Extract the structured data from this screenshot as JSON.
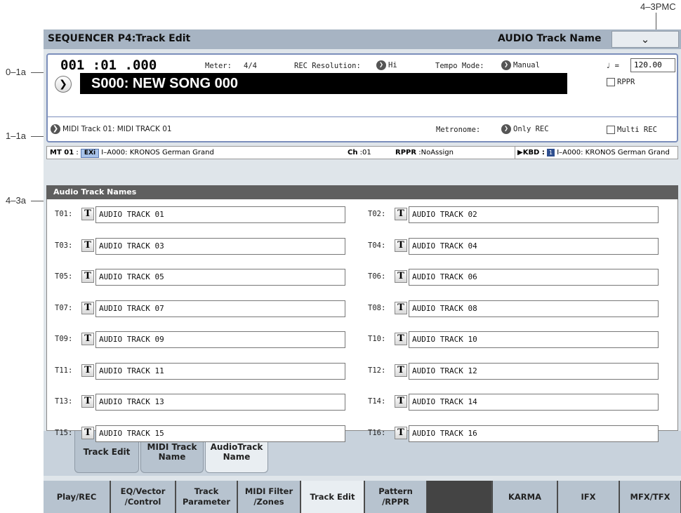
{
  "annotations": {
    "top_right": "4–3PMC",
    "label_0_1a": "0–1a",
    "label_1_1a": "1–1a",
    "label_4_3a": "4–3a"
  },
  "titlebar": {
    "title": "SEQUENCER P4:Track Edit",
    "page_name": "AUDIO Track Name",
    "menu_glyph": "⌵"
  },
  "info": {
    "location": "001 :01 .000",
    "meter_label": "Meter:",
    "meter_value": "4/4",
    "rec_res_label": "REC Resolution:",
    "rec_res_value": "Hi",
    "tempo_mode_label": "Tempo Mode:",
    "tempo_mode_value": "Manual",
    "tempo_symbol": "♩ =",
    "tempo_value": "120.00",
    "song_name": "S000: NEW SONG 000",
    "rppr_label": "RPPR",
    "midi_track": "MIDI Track 01: MIDI TRACK 01",
    "metronome_label": "Metronome:",
    "metronome_value": "Only REC",
    "multi_rec_label": "Multi REC"
  },
  "status": {
    "mt": "MT 01",
    "sep1": ":",
    "bank_badge": "EXi",
    "program": "I–A000: KRONOS German Grand",
    "ch_label": "Ch",
    "ch_value": ":01",
    "rppr_label": "RPPR",
    "rppr_value": ":NoAssign",
    "kbd_label": "▶KBD :",
    "kbd_badge": "1",
    "kbd_program": "I–A000: KRONOS German Grand"
  },
  "section_title": "Audio Track Names",
  "tracks": [
    {
      "label": "T01:",
      "name": "AUDIO TRACK 01"
    },
    {
      "label": "T02:",
      "name": "AUDIO TRACK 02"
    },
    {
      "label": "T03:",
      "name": "AUDIO TRACK 03"
    },
    {
      "label": "T04:",
      "name": "AUDIO TRACK 04"
    },
    {
      "label": "T05:",
      "name": "AUDIO TRACK 05"
    },
    {
      "label": "T06:",
      "name": "AUDIO TRACK 06"
    },
    {
      "label": "T07:",
      "name": "AUDIO TRACK 07"
    },
    {
      "label": "T08:",
      "name": "AUDIO TRACK 08"
    },
    {
      "label": "T09:",
      "name": "AUDIO TRACK 09"
    },
    {
      "label": "T10:",
      "name": "AUDIO TRACK 10"
    },
    {
      "label": "T11:",
      "name": "AUDIO TRACK 11"
    },
    {
      "label": "T12:",
      "name": "AUDIO TRACK 12"
    },
    {
      "label": "T13:",
      "name": "AUDIO TRACK 13"
    },
    {
      "label": "T14:",
      "name": "AUDIO TRACK 14"
    },
    {
      "label": "T15:",
      "name": "AUDIO TRACK 15"
    },
    {
      "label": "T16:",
      "name": "AUDIO TRACK 16"
    }
  ],
  "text_button_glyph": "T",
  "subtabs": [
    "Track Edit",
    "MIDI Track Name",
    "AudioTrack Name"
  ],
  "maintabs": [
    "Play/REC",
    "EQ/Vector /Control",
    "Track Parameter",
    "MIDI Filter /Zones",
    "Track Edit",
    "Pattern /RPPR",
    "",
    "KARMA",
    "IFX",
    "MFX/TFX"
  ]
}
